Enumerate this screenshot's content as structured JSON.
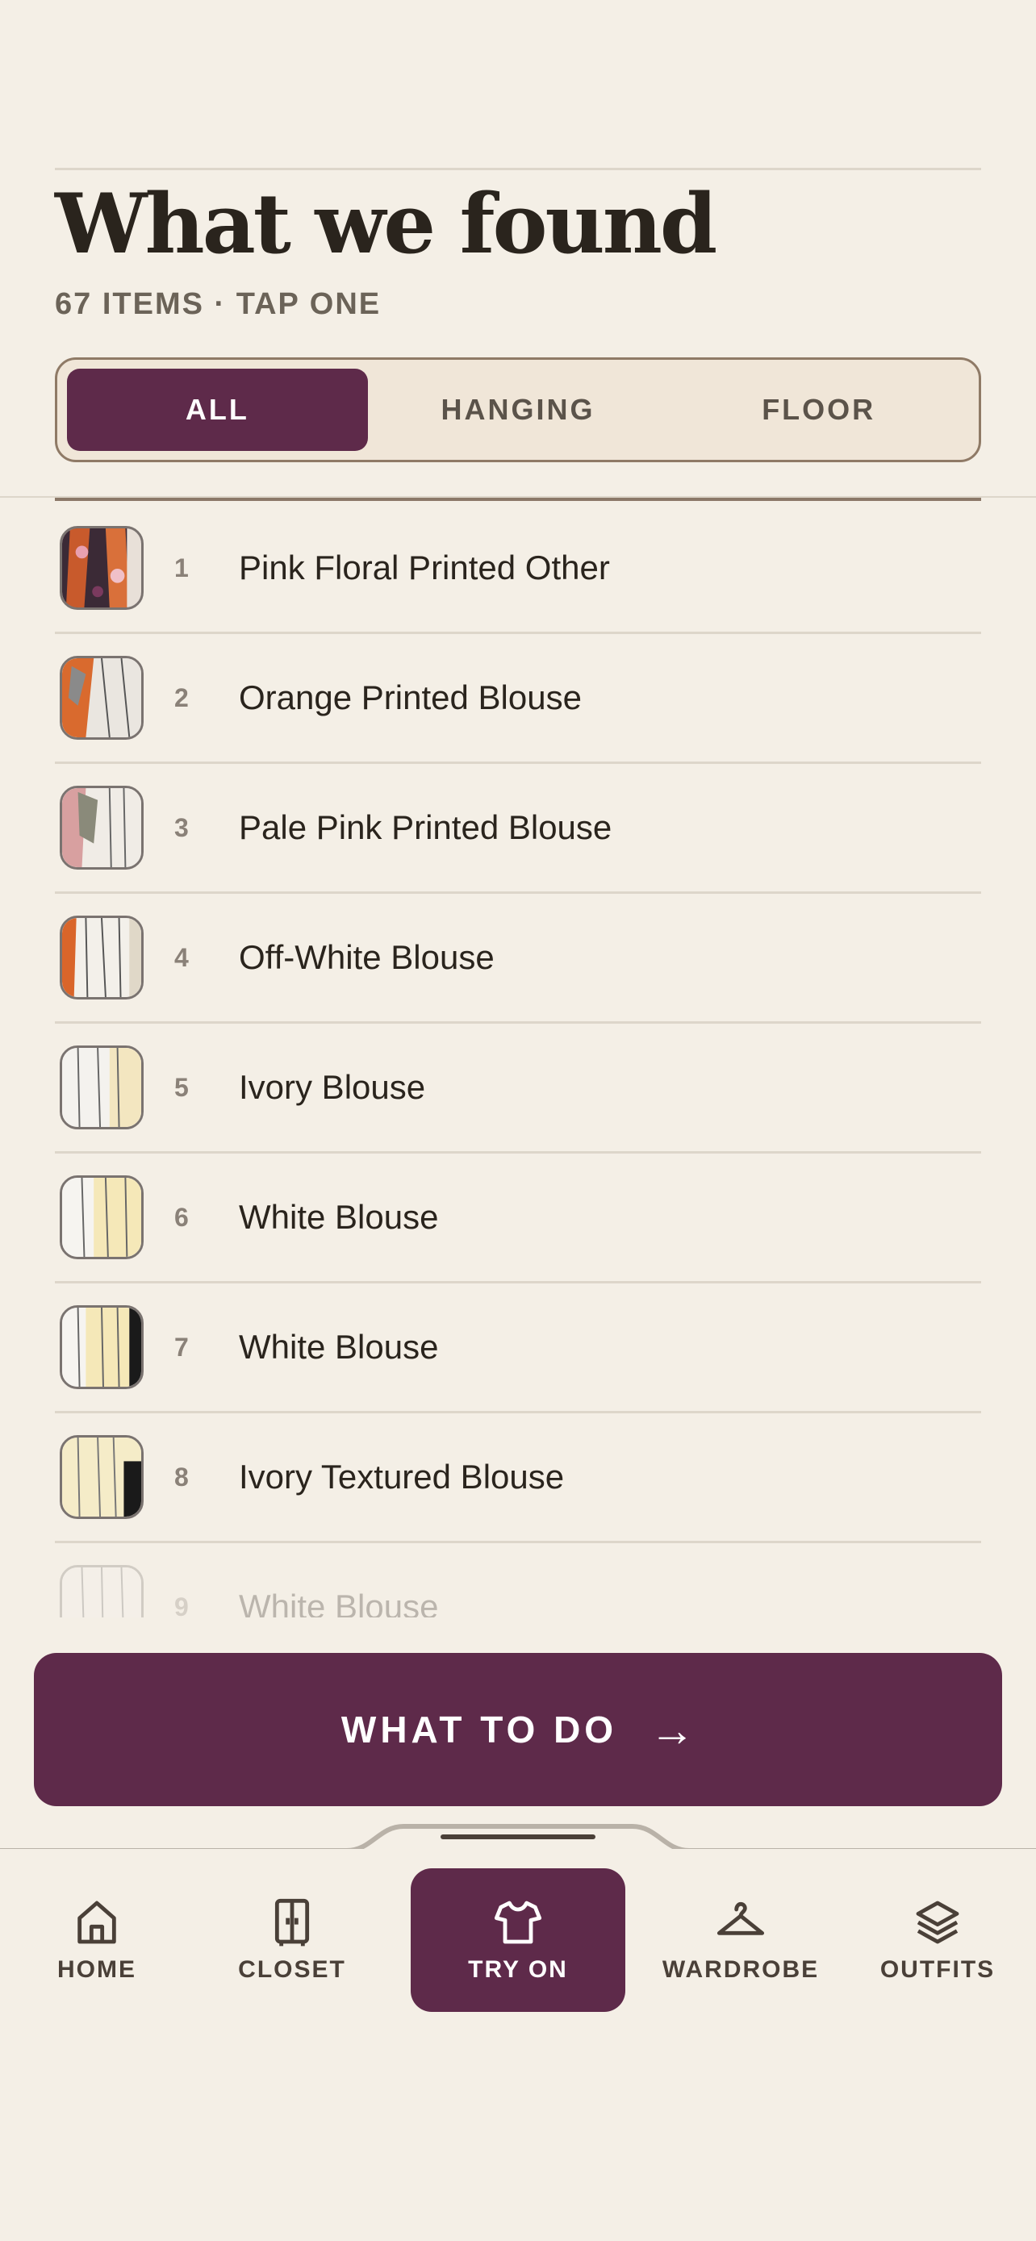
{
  "header": {
    "title": "What we found",
    "subtitle": "67 ITEMS · TAP ONE"
  },
  "filters": {
    "options": [
      "ALL",
      "HANGING",
      "FLOOR"
    ],
    "selected": "ALL"
  },
  "items": [
    {
      "num": "1",
      "name": "Pink Floral Printed Other"
    },
    {
      "num": "2",
      "name": "Orange Printed Blouse"
    },
    {
      "num": "3",
      "name": "Pale Pink Printed Blouse"
    },
    {
      "num": "4",
      "name": "Off-White Blouse"
    },
    {
      "num": "5",
      "name": "Ivory Blouse"
    },
    {
      "num": "6",
      "name": "White Blouse"
    },
    {
      "num": "7",
      "name": "White Blouse"
    },
    {
      "num": "8",
      "name": "Ivory Textured Blouse"
    },
    {
      "num": "9",
      "name": "White Blouse"
    }
  ],
  "cta": {
    "label": "WHAT TO DO",
    "arrow": "→"
  },
  "tabs": [
    {
      "label": "HOME",
      "icon": "home-icon"
    },
    {
      "label": "CLOSET",
      "icon": "closet-icon"
    },
    {
      "label": "TRY ON",
      "icon": "tshirt-icon",
      "active": true
    },
    {
      "label": "WARDROBE",
      "icon": "hanger-icon"
    },
    {
      "label": "OUTFITS",
      "icon": "layers-icon"
    }
  ],
  "colors": {
    "accent": "#5e2a4a",
    "background": "#f4efe6",
    "text": "#2a241d"
  }
}
